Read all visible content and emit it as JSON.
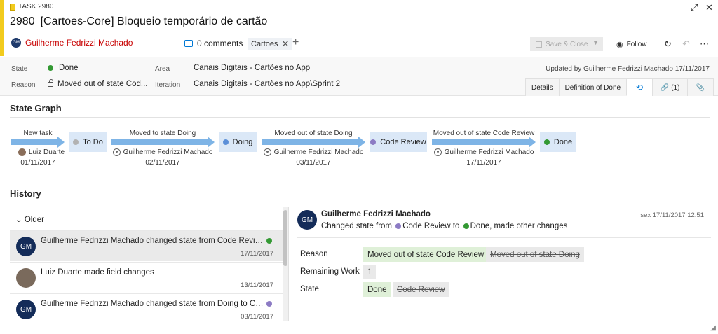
{
  "header": {
    "work_item_type": "TASK 2980",
    "id": "2980",
    "title": "[Cartoes-Core] Bloqueio temporário de cartão",
    "assignee_initials": "GM",
    "assignee": "Guilherme Fedrizzi Machado",
    "comments": "0 comments",
    "tag": "Cartoes",
    "save_close": "Save & Close",
    "follow": "Follow",
    "colors": {
      "accent_bar": "#f2cb1d",
      "assignee_text": "#c80000",
      "link_blue": "#0078d4"
    },
    "icons": [
      "expand-icon",
      "close-icon",
      "comment-icon",
      "tag-remove-icon",
      "add-tag-icon",
      "save-icon",
      "dropdown-icon",
      "eye-icon",
      "refresh-icon",
      "undo-icon",
      "more-icon"
    ]
  },
  "fields": {
    "state_label": "State",
    "state_value": "Done",
    "reason_label": "Reason",
    "reason_value": "Moved out of state Cod...",
    "area_label": "Area",
    "area_value": "Canais Digitais - Cartões no App",
    "iteration_label": "Iteration",
    "iteration_value": "Canais Digitais - Cartões no App\\Sprint 2",
    "updated": "Updated by Guilherme Fedrizzi Machado 17/11/2017"
  },
  "tabs": [
    "Details",
    "Definition of Done",
    "",
    "(1)",
    ""
  ],
  "state_graph": {
    "title": "State Graph",
    "transitions": [
      {
        "label": "New task",
        "user": "Luiz Duarte",
        "date": "01/11/2017"
      },
      {
        "label": "Moved to state Doing",
        "user": "Guilherme Fedrizzi Machado",
        "date": "02/11/2017"
      },
      {
        "label": "Moved out of state Doing",
        "user": "Guilherme Fedrizzi Machado",
        "date": "03/11/2017"
      },
      {
        "label": "Moved out of state Code Review",
        "user": "Guilherme Fedrizzi Machado",
        "date": "17/11/2017"
      }
    ],
    "states": [
      {
        "name": "To Do",
        "color": "#b2b2b2"
      },
      {
        "name": "Doing",
        "color": "#5b8fd8"
      },
      {
        "name": "Code Review",
        "color": "#8c7bc4"
      },
      {
        "name": "Done",
        "color": "#339933"
      }
    ]
  },
  "history": {
    "title": "History",
    "group": "Older",
    "items": [
      {
        "initials": "GM",
        "text": "Guilherme Fedrizzi Machado changed state from Code Review to Done, made other changes",
        "date": "17/11/2017",
        "dot_color": "#339933"
      },
      {
        "initials": "",
        "text": "Luiz Duarte made field changes",
        "date": "13/11/2017",
        "dot_color": ""
      },
      {
        "initials": "GM",
        "text": "Guilherme Fedrizzi Machado changed state from Doing to Code Review",
        "date": "03/11/2017",
        "dot_color": "#8c7bc4"
      }
    ],
    "detail": {
      "initials": "GM",
      "name": "Guilherme Fedrizzi Machado",
      "date": "sex 17/11/2017 12:51",
      "summary_prefix": "Changed state from",
      "from_state": "Code Review",
      "to_word": "to",
      "to_state": "Done",
      "summary_suffix": ", made other changes",
      "rows": [
        {
          "label": "Reason",
          "new": "Moved out of state Code Review",
          "old": "Moved out of state Doing"
        },
        {
          "label": "Remaining Work",
          "new": "",
          "old": "1"
        },
        {
          "label": "State",
          "new": "Done",
          "old": "Code Review"
        }
      ]
    }
  }
}
